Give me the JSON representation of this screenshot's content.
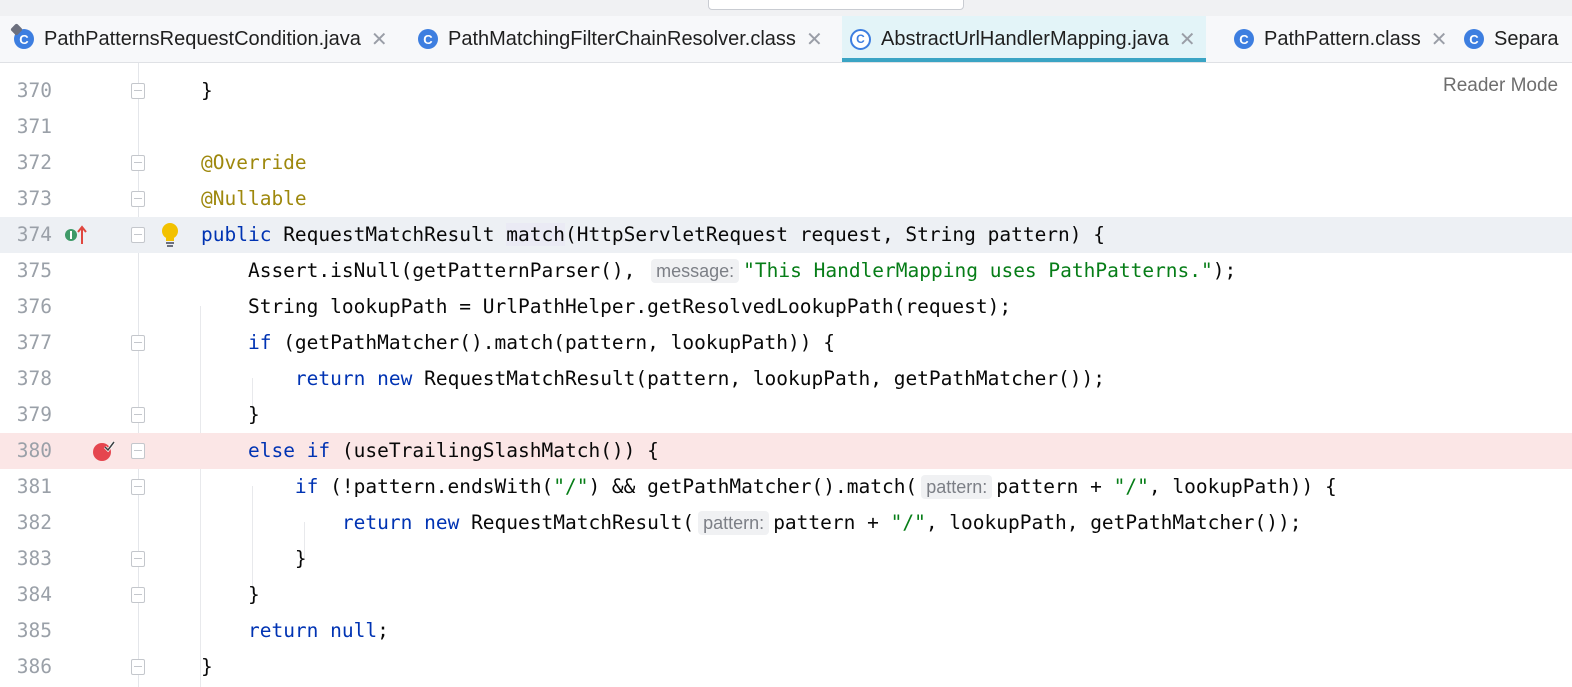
{
  "tabs": [
    {
      "label": "PathPatternsRequestCondition.java",
      "icon": "class-icon"
    },
    {
      "label": "PathMatchingFilterChainResolver.class",
      "icon": "class-icon"
    },
    {
      "label": "AbstractUrlHandlerMapping.java",
      "icon": "class-icon",
      "active": true
    },
    {
      "label": "PathPattern.class",
      "icon": "class-icon"
    },
    {
      "label": "Separa",
      "icon": "class-icon"
    }
  ],
  "tab_close_symbol": "✕",
  "class_icon_letter": "C",
  "reader_mode": "Reader Mode",
  "lines": {
    "l370": {
      "num": "370",
      "c": "}"
    },
    "l371": {
      "num": "371"
    },
    "l372": {
      "num": "372",
      "c": "@Override"
    },
    "l373": {
      "num": "373",
      "c": "@Nullable"
    },
    "l374": {
      "num": "374",
      "kw1": "public",
      "a": " RequestMatchResult ",
      "m": "match",
      "b": "(HttpServletRequest request, String pattern) {"
    },
    "l375": {
      "num": "375",
      "a": "    Assert.isNull(getPatternParser(), ",
      "hint": "message:",
      "s": "\"This HandlerMapping uses PathPatterns.\"",
      "b": ");"
    },
    "l376": {
      "num": "376",
      "a": "    String lookupPath = UrlPathHelper.getResolvedLookupPath(request);"
    },
    "l377": {
      "num": "377",
      "i": "    ",
      "kw1": "if",
      "a": " (getPathMatcher().match(pattern, lookupPath)) {"
    },
    "l378": {
      "num": "378",
      "i": "        ",
      "kw1": "return",
      "sp": " ",
      "kw2": "new",
      "a": " RequestMatchResult(pattern, lookupPath, getPathMatcher());"
    },
    "l379": {
      "num": "379",
      "c": "    }"
    },
    "l380": {
      "num": "380",
      "i": "    ",
      "kw1": "else",
      "sp": " ",
      "kw2": "if",
      "a": " (useTrailingSlashMatch()) {"
    },
    "l381": {
      "num": "381",
      "i": "        ",
      "kw1": "if",
      "a": " (!pattern.endsWith(",
      "s1": "\"/\"",
      "b": ") && getPathMatcher().match(",
      "hint": "pattern:",
      "c2": "pattern + ",
      "s2": "\"/\"",
      "d": ", lookupPath)) {"
    },
    "l382": {
      "num": "382",
      "i": "            ",
      "kw1": "return",
      "sp": " ",
      "kw2": "new",
      "a": " RequestMatchResult(",
      "hint": "pattern:",
      "c2": "pattern + ",
      "s2": "\"/\"",
      "d": ", lookupPath, getPathMatcher());"
    },
    "l383": {
      "num": "383",
      "c": "        }"
    },
    "l384": {
      "num": "384",
      "c": "    }"
    },
    "l385": {
      "num": "385",
      "i": "    ",
      "kw1": "return",
      "sp": " ",
      "kw2": "null",
      "a": ";"
    },
    "l386": {
      "num": "386",
      "c": "}"
    }
  }
}
